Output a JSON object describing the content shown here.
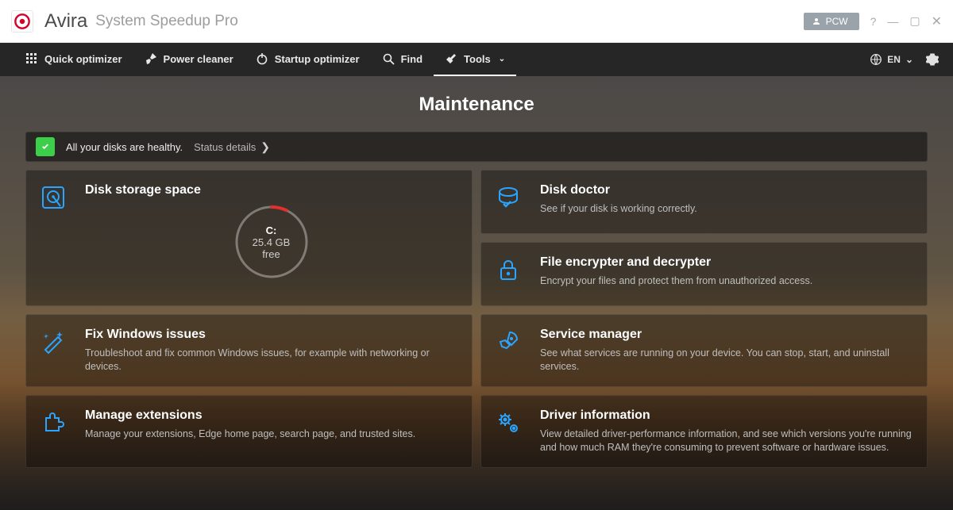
{
  "brand_name": "Avira",
  "app_name": "System Speedup Pro",
  "user_label": "PCW",
  "toolbar": {
    "quick_optimizer": "Quick optimizer",
    "power_cleaner": "Power cleaner",
    "startup_optimizer": "Startup optimizer",
    "find": "Find",
    "tools": "Tools",
    "language": "EN"
  },
  "page_title": "Maintenance",
  "status": {
    "message": "All your disks are healthy.",
    "details_label": "Status details"
  },
  "disk_card": {
    "title": "Disk storage space",
    "drive_label": "C:",
    "free_value": "25.4 GB",
    "free_label": "free",
    "used_fraction": 0.07
  },
  "cards": {
    "disk_doctor": {
      "title": "Disk doctor",
      "desc": "See if your disk is working correctly."
    },
    "file_encrypter": {
      "title": "File encrypter and decrypter",
      "desc": "Encrypt your files and protect them from unauthorized access."
    },
    "fix_windows": {
      "title": "Fix Windows issues",
      "desc": "Troubleshoot and fix common Windows issues, for example with networking or devices."
    },
    "service_manager": {
      "title": "Service manager",
      "desc": "See what services are running on your device. You can stop, start, and uninstall services."
    },
    "manage_extensions": {
      "title": "Manage extensions",
      "desc": "Manage your extensions, Edge home page, search page, and trusted sites."
    },
    "driver_info": {
      "title": "Driver information",
      "desc": "View detailed driver-performance information, and see which versions you're running and how much RAM they're consuming to prevent software or hardware issues."
    }
  },
  "colors": {
    "accent_blue": "#2aa5ff",
    "status_green": "#3bcf4a",
    "gauge_red": "#e03030"
  }
}
